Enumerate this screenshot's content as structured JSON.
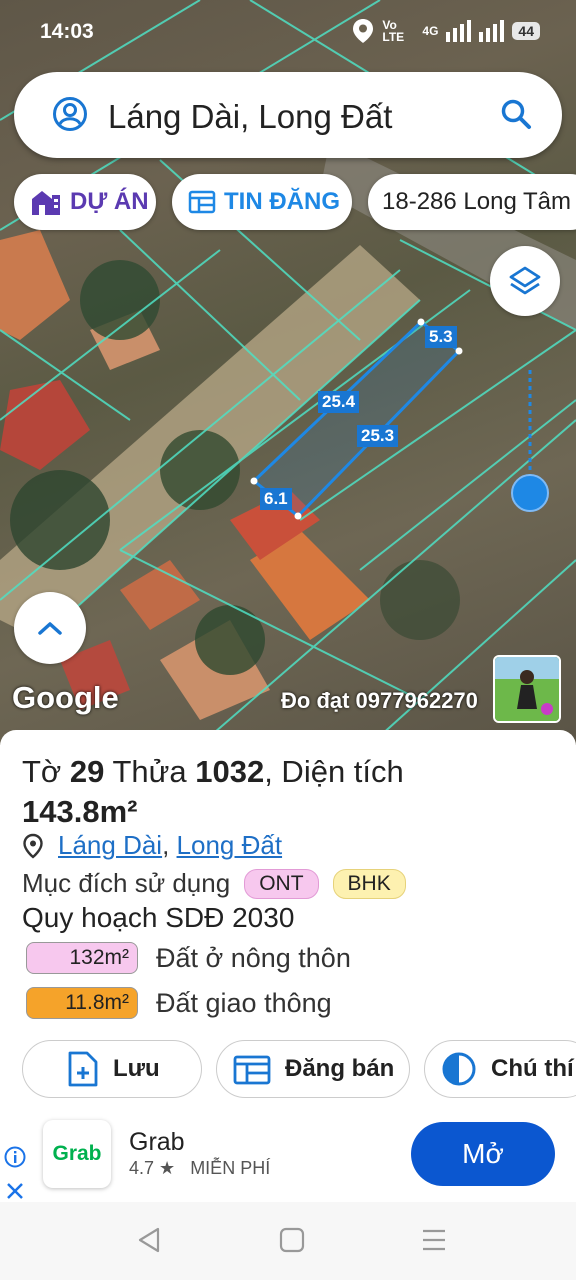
{
  "status": {
    "time": "14:03",
    "network": "Vo LTE",
    "signal": "4G",
    "battery": "44"
  },
  "search": {
    "query": "Láng Dài, Long Đất"
  },
  "chips": {
    "project": "DỰ ÁN",
    "listing": "TIN ĐĂNG",
    "address": "18-286 Long Tâm"
  },
  "map": {
    "dims": {
      "top": "5.3",
      "left_long": "25.4",
      "right_long": "25.3",
      "bottom": "6.1"
    },
    "brand": "Google",
    "credit": "Đo đạt 0977962270"
  },
  "parcel": {
    "title_prefix": "Tờ",
    "sheet": "29",
    "plot_label": "Thửa",
    "plot": "1032",
    "area_label": ", Diện tích",
    "area": "143.8m²",
    "commune": "Láng Dài",
    "district": "Long Đất",
    "purpose_label": "Mục đích sử dụng",
    "purpose_tags": [
      "ONT",
      "BHK"
    ],
    "plan_title": "Quy hoạch SDĐ 2030",
    "plan_rows": [
      {
        "area": "132m²",
        "label": "Đất ở nông thôn",
        "color": "#f7c8ee"
      },
      {
        "area": "11.8m²",
        "label": "Đất giao thông",
        "color": "#f5a32a"
      }
    ]
  },
  "actions": {
    "save": "Lưu",
    "sell": "Đăng bán",
    "note": "Chú thí"
  },
  "ad": {
    "logo": "Grab",
    "name": "Grab",
    "rating": "4.7 ★",
    "price": "MIỄN PHÍ",
    "cta": "Mở"
  },
  "colors": {
    "accent": "#1e88e5",
    "project": "#5b3ab1",
    "cta": "#0b57d0"
  }
}
